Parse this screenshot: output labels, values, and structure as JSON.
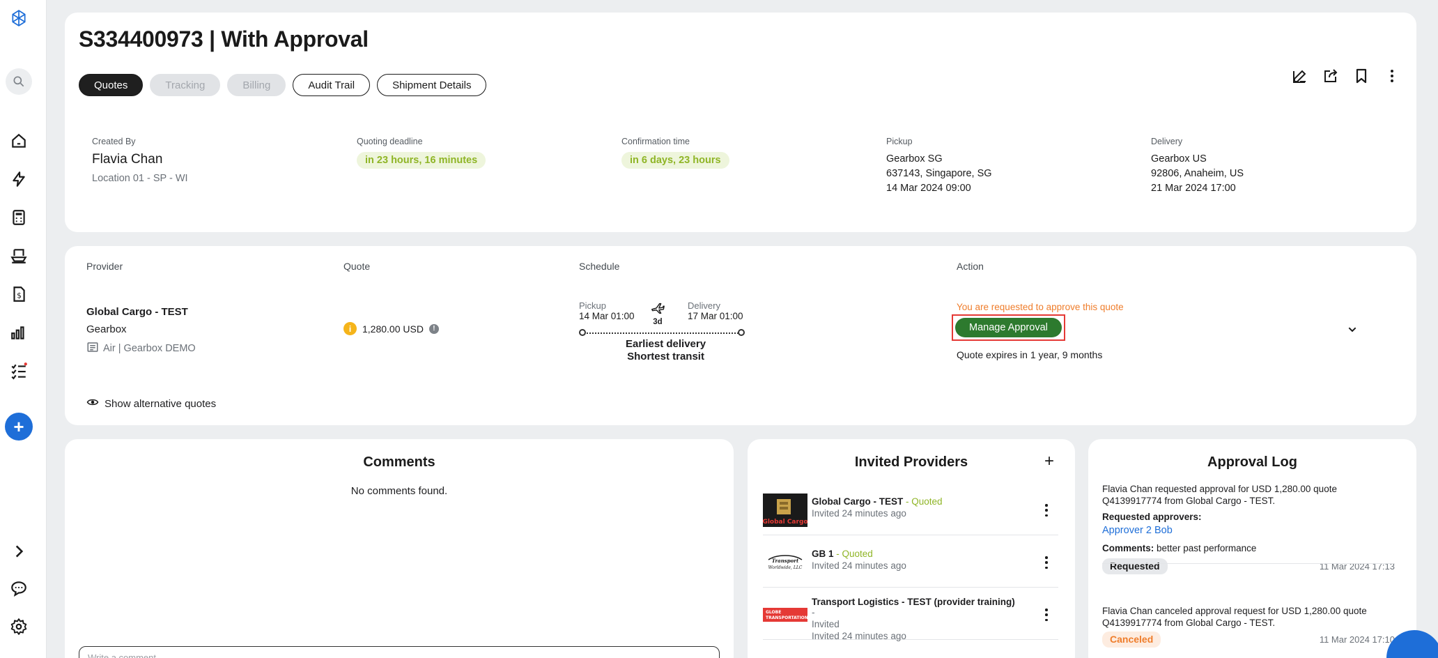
{
  "header": {
    "title": "S334400973 | With Approval",
    "tabs": [
      "Quotes",
      "Tracking",
      "Billing",
      "Audit Trail",
      "Shipment Details"
    ]
  },
  "summary": {
    "created_by": {
      "label": "Created By",
      "name": "Flavia Chan",
      "location": "Location 01 - SP - WI"
    },
    "quoting_deadline": {
      "label": "Quoting deadline",
      "value": "in 23 hours, 16 minutes"
    },
    "confirmation_time": {
      "label": "Confirmation time",
      "value": "in 6 days, 23 hours"
    },
    "pickup": {
      "label": "Pickup",
      "name": "Gearbox SG",
      "address": "637143, Singapore, SG",
      "date": "14 Mar 2024 09:00"
    },
    "delivery": {
      "label": "Delivery",
      "name": "Gearbox US",
      "address": "92806, Anaheim, US",
      "date": "21 Mar 2024 17:00"
    }
  },
  "quote_table": {
    "headers": {
      "provider": "Provider",
      "quote": "Quote",
      "schedule": "Schedule",
      "action": "Action"
    },
    "row": {
      "provider_name": "Global Cargo - TEST",
      "provider_org": "Gearbox",
      "mode": "Air | Gearbox DEMO",
      "quote_value": "1,280.00 USD",
      "pickup_label": "Pickup",
      "pickup_date": "14 Mar 01:00",
      "delivery_label": "Delivery",
      "delivery_date": "17 Mar 01:00",
      "transit": "3d",
      "tag1": "Earliest delivery",
      "tag2": "Shortest transit",
      "approval_notice": "You are requested to approve this quote",
      "manage_button": "Manage Approval",
      "expires": "Quote expires in 1 year, 9 months"
    },
    "alt_quotes": "Show alternative quotes"
  },
  "comments": {
    "title": "Comments",
    "empty": "No comments found.",
    "placeholder": "Write a comment..."
  },
  "invited": {
    "title": "Invited Providers",
    "add": "+",
    "providers": [
      {
        "name": "Global Cargo - TEST",
        "sep": " - ",
        "status": "Quoted",
        "time": "Invited 24 minutes ago"
      },
      {
        "name": "GB 1",
        "sep": " - ",
        "status": "Quoted",
        "time": "Invited 24 minutes ago"
      },
      {
        "name": "Transport Logistics - TEST (provider training)",
        "sep": " - ",
        "status": "Invited",
        "time": "Invited 24 minutes ago"
      }
    ]
  },
  "approval_log": {
    "title": "Approval Log",
    "entries": [
      {
        "text": "Flavia Chan requested approval for USD 1,280.00 quote Q4139917774 from Global Cargo - TEST.",
        "approvers_label": "Requested approvers:",
        "approver": "Approver 2 Bob",
        "comments_label": "Comments:",
        "comments": " better past performance",
        "status": "Requested",
        "date": "11 Mar 2024 17:13"
      },
      {
        "text": "Flavia Chan canceled approval request for USD 1,280.00 quote Q4139917774 from Global Cargo - TEST.",
        "status": "Canceled",
        "date": "11 Mar 2024 17:10"
      }
    ]
  },
  "colors": {
    "accent": "#1e6ed8",
    "approve_green": "#2d7a2e",
    "quoted_green": "#8fb526",
    "warning_orange": "#ef7d2b"
  }
}
